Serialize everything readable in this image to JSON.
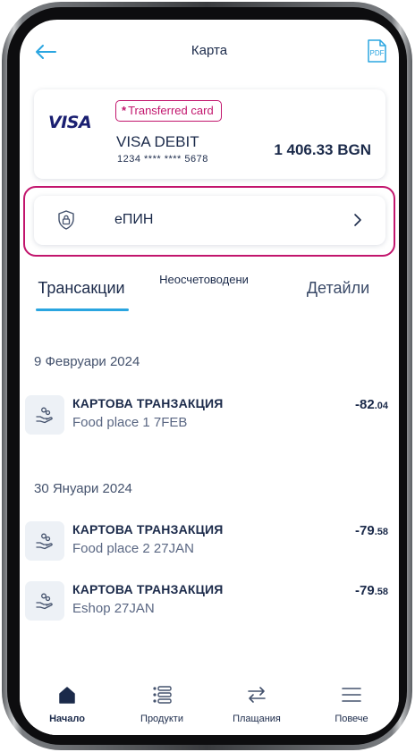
{
  "header": {
    "title": "Карта",
    "back_icon": "arrow-left-icon",
    "pdf_icon": "pdf-icon",
    "pdf_label": "PDF"
  },
  "card": {
    "brand": "VISA",
    "badge": "Transferred card",
    "badge_star": "*",
    "name": "VISA DEBIT",
    "number": "1234 **** **** 5678",
    "balance": "1 406.33 BGN"
  },
  "epin": {
    "label": "еПИН",
    "icon": "shield-lock-icon",
    "chevron": "chevron-right-icon"
  },
  "tabs": [
    {
      "label": "Трансакции",
      "active": true
    },
    {
      "label": "Неосчетоводени",
      "active": false
    },
    {
      "label": "Детайли",
      "active": false
    }
  ],
  "transactions": {
    "groups": [
      {
        "date": "9 Февруари 2024",
        "items": [
          {
            "title": "КАРТОВА ТРАНЗАКЦИЯ",
            "subtitle": "Food place 1  7FEB",
            "amount_int": "-82",
            "amount_dec": ".04"
          }
        ]
      },
      {
        "date": "30 Януари 2024",
        "items": [
          {
            "title": "КАРТОВА ТРАНЗАКЦИЯ",
            "subtitle": "Food place 2  27JAN",
            "amount_int": "-79",
            "amount_dec": ".58"
          },
          {
            "title": "КАРТОВА ТРАНЗАКЦИЯ",
            "subtitle": "Eshop  27JAN",
            "amount_int": "-79",
            "amount_dec": ".58"
          }
        ]
      }
    ]
  },
  "bottom_nav": [
    {
      "label": "Начало",
      "icon": "home-icon",
      "active": true
    },
    {
      "label": "Продукти",
      "icon": "products-list-icon",
      "active": false
    },
    {
      "label": "Плащания",
      "icon": "transfer-arrows-icon",
      "active": false
    },
    {
      "label": "Повече",
      "icon": "menu-icon",
      "active": false
    }
  ],
  "colors": {
    "accent": "#2aa5e0",
    "highlight": "#c2156d",
    "text": "#1b2a4a",
    "visa_blue": "#1a1f71"
  }
}
